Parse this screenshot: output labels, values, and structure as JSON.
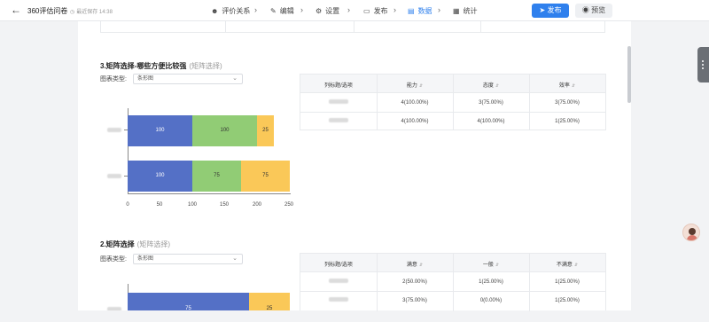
{
  "header": {
    "back_icon": "arrow-left-icon",
    "title": "360评估问卷",
    "saved": "最近保存 14:38",
    "steps": [
      {
        "label": "评价关系",
        "icon": "user-icon"
      },
      {
        "label": "编辑",
        "icon": "edit-icon"
      },
      {
        "label": "设置",
        "icon": "gear-icon"
      },
      {
        "label": "发布",
        "icon": "file-icon"
      },
      {
        "label": "数据",
        "icon": "document-icon",
        "active": true
      },
      {
        "label": "统计",
        "icon": "chart-icon"
      }
    ],
    "publish_label": "发布",
    "preview_label": "预览"
  },
  "question3": {
    "title": "3.矩阵选择-哪些方便比较强",
    "type": "(矩阵选择)",
    "chart_type_label": "图表类型:",
    "chart_type_value": "条形图",
    "table": {
      "headers": [
        "列标题/选项",
        "能力",
        "态度",
        "效率"
      ],
      "rows": [
        [
          "",
          "4(100.00%)",
          "3(75.00%)",
          "3(75.00%)"
        ],
        [
          "",
          "4(100.00%)",
          "4(100.00%)",
          "1(25.00%)"
        ]
      ]
    }
  },
  "question2": {
    "title": "2.矩阵选择",
    "type": "(矩阵选择)",
    "chart_type_label": "图表类型:",
    "chart_type_value": "条形图",
    "table": {
      "headers": [
        "列标题/选项",
        "满意",
        "一般",
        "不满意"
      ],
      "rows": [
        [
          "",
          "2(50.00%)",
          "1(25.00%)",
          "1(25.00%)"
        ],
        [
          "",
          "3(75.00%)",
          "0(0.00%)",
          "1(25.00%)"
        ]
      ]
    }
  },
  "chart_data": [
    {
      "type": "bar",
      "orientation": "horizontal",
      "stacked": true,
      "categories": [
        "",
        ""
      ],
      "series": [
        {
          "values": [
            100,
            100
          ],
          "color": "#5470c6"
        },
        {
          "values": [
            100,
            75
          ],
          "color": "#91cc75"
        },
        {
          "values": [
            25,
            75
          ],
          "color": "#fac858"
        }
      ],
      "xlim": [
        0,
        250
      ],
      "xticks": [
        "0",
        "50",
        "100",
        "150",
        "200",
        "250"
      ]
    },
    {
      "type": "bar",
      "orientation": "horizontal",
      "stacked": true,
      "categories": [
        ""
      ],
      "series": [
        {
          "values": [
            75
          ],
          "color": "#5470c6"
        },
        {
          "values": [
            25
          ],
          "color": "#fac858"
        }
      ]
    }
  ]
}
